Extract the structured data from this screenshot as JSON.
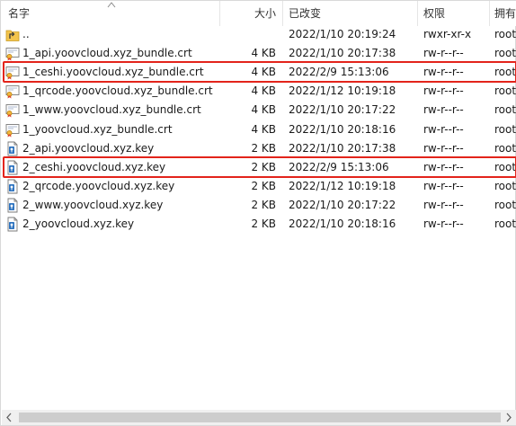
{
  "columns": {
    "name": "名字",
    "size": "大小",
    "modified": "已改变",
    "permissions": "权限",
    "owner": "拥有"
  },
  "files": [
    {
      "name": "..",
      "size": "",
      "modified": "2022/1/10 20:19:24",
      "permissions": "rwxr-xr-x",
      "owner": "root",
      "icon": "parent-folder-icon",
      "highlighted": false
    },
    {
      "name": "1_api.yoovcloud.xyz_bundle.crt",
      "size": "4 KB",
      "modified": "2022/1/10 20:17:38",
      "permissions": "rw-r--r--",
      "owner": "root",
      "icon": "certificate-file-icon",
      "highlighted": false
    },
    {
      "name": "1_ceshi.yoovcloud.xyz_bundle.crt",
      "size": "4 KB",
      "modified": "2022/2/9 15:13:06",
      "permissions": "rw-r--r--",
      "owner": "root",
      "icon": "certificate-file-icon",
      "highlighted": true
    },
    {
      "name": "1_qrcode.yoovcloud.xyz_bundle.crt",
      "size": "4 KB",
      "modified": "2022/1/12 10:19:18",
      "permissions": "rw-r--r--",
      "owner": "root",
      "icon": "certificate-file-icon",
      "highlighted": false
    },
    {
      "name": "1_www.yoovcloud.xyz_bundle.crt",
      "size": "4 KB",
      "modified": "2022/1/10 20:17:22",
      "permissions": "rw-r--r--",
      "owner": "root",
      "icon": "certificate-file-icon",
      "highlighted": false
    },
    {
      "name": "1_yoovcloud.xyz_bundle.crt",
      "size": "4 KB",
      "modified": "2022/1/10 20:18:16",
      "permissions": "rw-r--r--",
      "owner": "root",
      "icon": "certificate-file-icon",
      "highlighted": false
    },
    {
      "name": "2_api.yoovcloud.xyz.key",
      "size": "2 KB",
      "modified": "2022/1/10 20:17:38",
      "permissions": "rw-r--r--",
      "owner": "root",
      "icon": "key-file-icon",
      "highlighted": false
    },
    {
      "name": "2_ceshi.yoovcloud.xyz.key",
      "size": "2 KB",
      "modified": "2022/2/9 15:13:06",
      "permissions": "rw-r--r--",
      "owner": "root",
      "icon": "key-file-icon",
      "highlighted": true
    },
    {
      "name": "2_qrcode.yoovcloud.xyz.key",
      "size": "2 KB",
      "modified": "2022/1/12 10:19:18",
      "permissions": "rw-r--r--",
      "owner": "root",
      "icon": "key-file-icon",
      "highlighted": false
    },
    {
      "name": "2_www.yoovcloud.xyz.key",
      "size": "2 KB",
      "modified": "2022/1/10 20:17:22",
      "permissions": "rw-r--r--",
      "owner": "root",
      "icon": "key-file-icon",
      "highlighted": false
    },
    {
      "name": "2_yoovcloud.xyz.key",
      "size": "2 KB",
      "modified": "2022/1/10 20:18:16",
      "permissions": "rw-r--r--",
      "owner": "root",
      "icon": "key-file-icon",
      "highlighted": false
    }
  ],
  "colors": {
    "highlight": "#e3241b",
    "header_separator": "#e5e5e5",
    "scrollbar_track": "#f0f0f0",
    "scrollbar_thumb": "#cdcdcd"
  }
}
